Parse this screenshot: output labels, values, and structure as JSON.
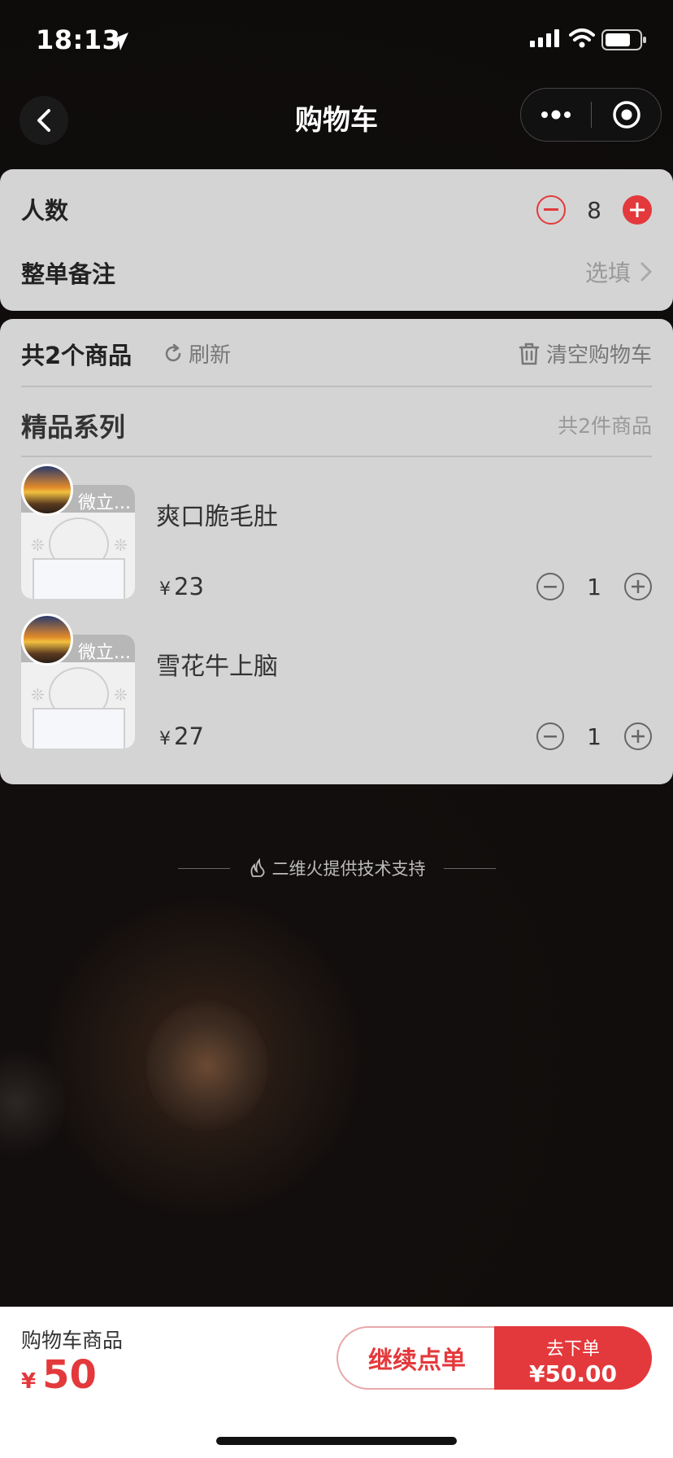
{
  "status_bar": {
    "time": "18:13"
  },
  "nav": {
    "title": "购物车"
  },
  "guests": {
    "label": "人数",
    "count": "8"
  },
  "remark": {
    "label": "整单备注",
    "placeholder": "选填"
  },
  "cart": {
    "count_label": "共2个商品",
    "refresh_label": "刷新",
    "clear_label": "清空购物车",
    "category": {
      "title": "精品系列",
      "count": "共2件商品"
    },
    "items": [
      {
        "name": "爽口脆毛肚",
        "currency": "¥",
        "price": "23",
        "qty": "1",
        "thumb_text": "微立..."
      },
      {
        "name": "雪花牛上脑",
        "currency": "¥",
        "price": "27",
        "qty": "1",
        "thumb_text": "微立..."
      }
    ]
  },
  "credit": "二维火提供技术支持",
  "bottom": {
    "label": "购物车商品",
    "currency": "¥",
    "total": "50",
    "continue_label": "继续点单",
    "order_label": "去下单",
    "order_amount": "¥50.00"
  },
  "colors": {
    "accent": "#e3393c",
    "card_bg": "#d4d4d4"
  }
}
